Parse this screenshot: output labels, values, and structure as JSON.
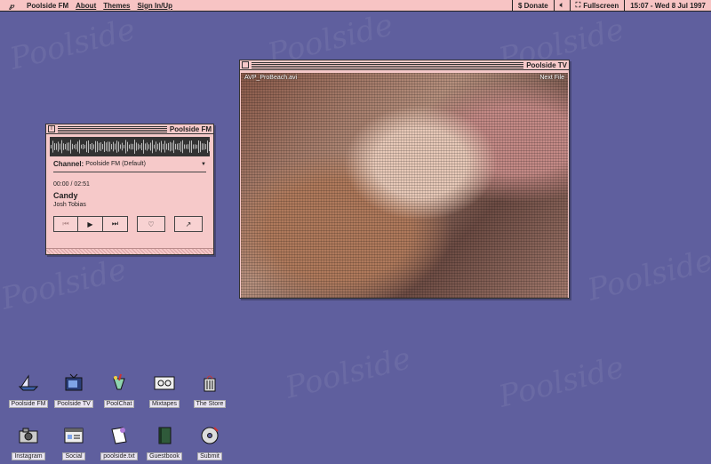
{
  "menubar": {
    "app_name": "Poolside FM",
    "menu": [
      "About",
      "Themes",
      "Sign In/Up"
    ],
    "donate": "$ Donate",
    "fullscreen": "Fullscreen",
    "clock": "15:07 - Wed 8 Jul 1997"
  },
  "player": {
    "title": "Poolside FM",
    "channel_label": "Channel:",
    "channel_value": "Poolside FM (Default)",
    "time": "00:00 / 02:51",
    "track": "Candy",
    "artist": "Josh Tobias"
  },
  "tv": {
    "title": "Poolside TV",
    "file": "AVP_ProBeach.avi",
    "next": "Next File"
  },
  "desktop_icons_row1": [
    {
      "label": "Poolside FM",
      "icon": "boat-icon"
    },
    {
      "label": "Poolside TV",
      "icon": "tv-icon"
    },
    {
      "label": "PoolChat",
      "icon": "drink-icon"
    },
    {
      "label": "Mixtapes",
      "icon": "cassette-icon"
    },
    {
      "label": "The Store",
      "icon": "store-icon"
    }
  ],
  "desktop_icons_row2": [
    {
      "label": "Instagram",
      "icon": "camera-icon"
    },
    {
      "label": "Social",
      "icon": "social-icon"
    },
    {
      "label": "poolside.txt",
      "icon": "document-icon"
    },
    {
      "label": "Guestbook",
      "icon": "book-icon"
    },
    {
      "label": "Submit",
      "icon": "disc-icon"
    }
  ],
  "colors": {
    "desktop": "#5f5f9e",
    "window": "#f6c9c9",
    "menubar": "#f7c4c4"
  }
}
